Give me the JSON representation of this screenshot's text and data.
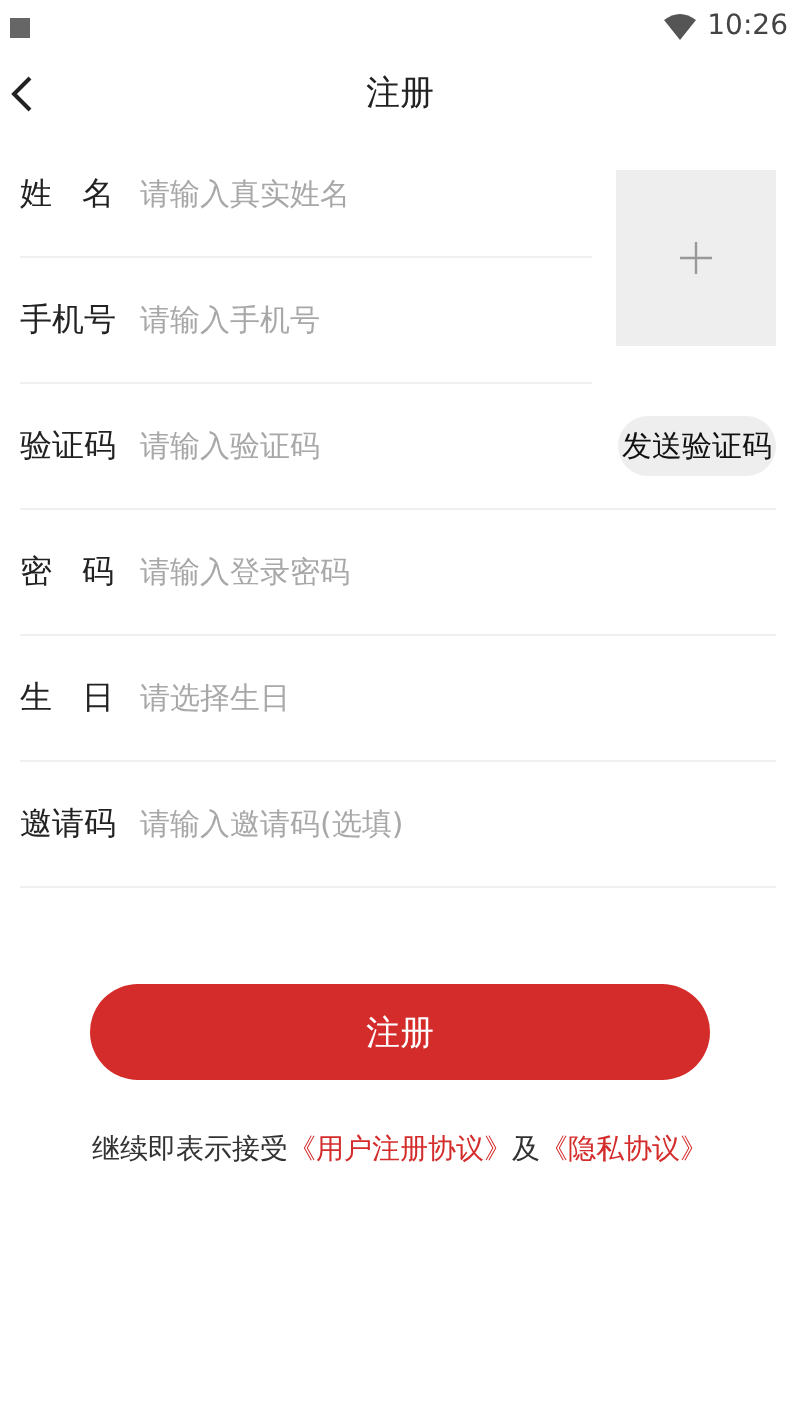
{
  "status_bar": {
    "time": "10:26"
  },
  "header": {
    "title": "注册"
  },
  "fields": [
    {
      "label": "姓 名",
      "placeholder": "请输入真实姓名"
    },
    {
      "label": "手机号",
      "placeholder": "请输入手机号"
    },
    {
      "label": "验证码",
      "placeholder": "请输入验证码",
      "action": "发送验证码"
    },
    {
      "label": "密 码",
      "placeholder": "请输入登录密码"
    },
    {
      "label": "生 日",
      "placeholder": "请选择生日"
    },
    {
      "label": "邀请码",
      "placeholder": "请输入邀请码(选填)"
    }
  ],
  "submit": "注册",
  "agreement": {
    "prefix": "继续即表示接受",
    "links": [
      "《用户注册协议》",
      "《隐私协议》"
    ],
    "joiner": "及"
  }
}
